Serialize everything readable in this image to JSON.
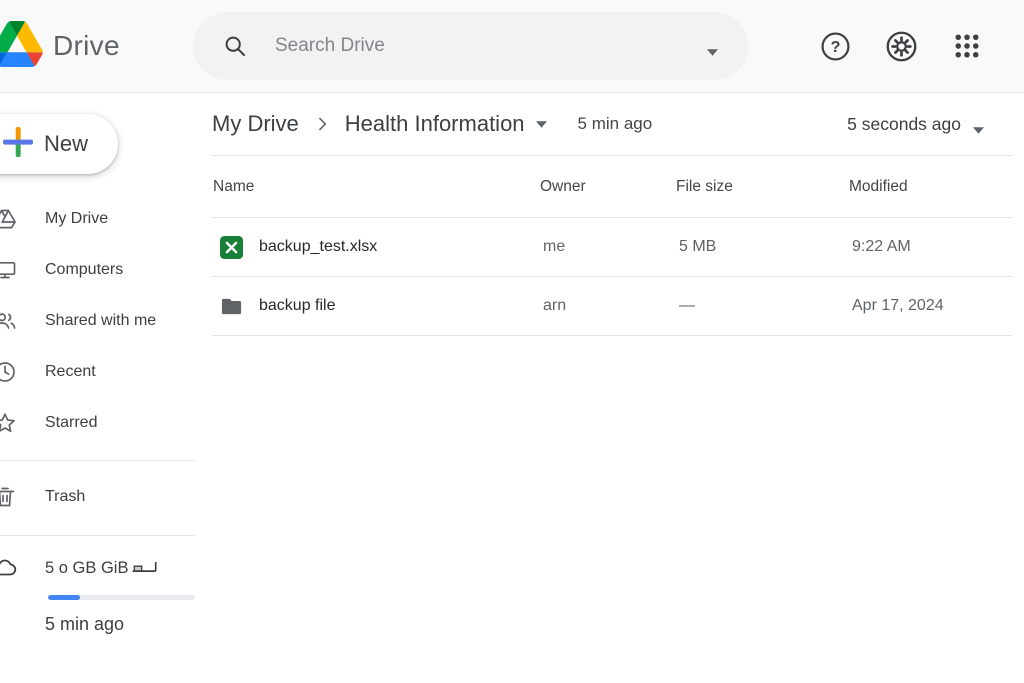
{
  "app_title": "Drive",
  "search": {
    "placeholder": "Search Drive"
  },
  "header_icons": [
    {
      "name": "help-icon"
    },
    {
      "name": "settings-icon"
    },
    {
      "name": "apps-grid-icon"
    }
  ],
  "sidebar": {
    "new_button_label": "New",
    "items": [
      {
        "label": "My Drive",
        "icon": "my-drive-icon"
      },
      {
        "label": "Computers",
        "icon": "computers-icon"
      },
      {
        "label": "Shared with me",
        "icon": "shared-with-me-icon"
      },
      {
        "label": "Recent",
        "icon": "recent-icon"
      },
      {
        "label": "Starred",
        "icon": "starred-icon"
      },
      {
        "label": "Trash",
        "icon": "trash-icon"
      }
    ],
    "storage": {
      "icon": "cloud-icon",
      "label": "5 o GB GiB",
      "percent_used_css": "22%",
      "updated_text": "5 min ago"
    }
  },
  "breadcrumb": {
    "root": "My Drive",
    "current": "Health Information",
    "modified_hint": "5 min ago",
    "sync_hint": "5 seconds ago"
  },
  "table": {
    "columns": {
      "name": "Name",
      "owner": "Owner",
      "size": "File size",
      "modified": "Modified"
    },
    "rows": [
      {
        "icon": "excel-file-icon",
        "name": "backup_test.xlsx",
        "owner": "me",
        "size": "5 MB",
        "modified": "9:22 AM"
      },
      {
        "icon": "folder-icon",
        "name": "backup file",
        "owner": "arn",
        "size": "—",
        "modified": "Apr 17, 2024"
      }
    ]
  },
  "colors": {
    "accent_blue": "#4285f4",
    "excel_green": "#188038",
    "icon_gray": "#5f6368",
    "text_dark": "#26282b",
    "progress_track": "#e8eaed"
  }
}
